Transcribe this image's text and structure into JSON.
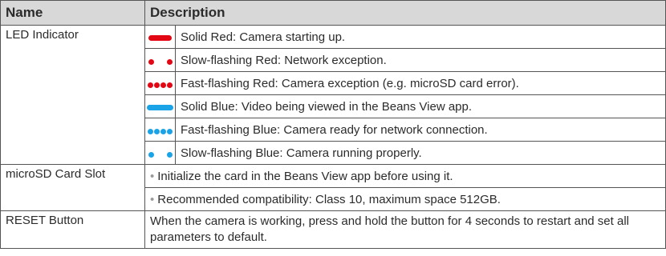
{
  "header": {
    "name": "Name",
    "description": "Description"
  },
  "colors": {
    "red": "#e30613",
    "blue": "#1aa3e6",
    "header_bg": "#d8d8d8"
  },
  "led": {
    "name": "LED Indicator",
    "states": [
      {
        "indicator": "solid",
        "color": "red",
        "text": "Solid Red: Camera starting up."
      },
      {
        "indicator": "slow-flashing",
        "color": "red",
        "text": "Slow-flashing Red: Network exception."
      },
      {
        "indicator": "fast-flashing",
        "color": "red",
        "text": "Fast-flashing Red: Camera exception (e.g. microSD card error)."
      },
      {
        "indicator": "solid",
        "color": "blue",
        "text": "Solid Blue: Video being viewed in the Beans View app."
      },
      {
        "indicator": "fast-flashing",
        "color": "blue",
        "text": "Fast-flashing Blue: Camera ready for network connection."
      },
      {
        "indicator": "slow-flashing",
        "color": "blue",
        "text": "Slow-flashing Blue: Camera running properly."
      }
    ]
  },
  "sd": {
    "name": "microSD Card Slot",
    "bullet": "•",
    "items": [
      "Initialize the card in the Beans View app before using it.",
      "Recommended compatibility: Class 10, maximum space 512GB."
    ]
  },
  "reset": {
    "name": "RESET Button",
    "text": "When the camera is working, press and hold the button for 4 seconds to restart and set all parameters to default."
  }
}
